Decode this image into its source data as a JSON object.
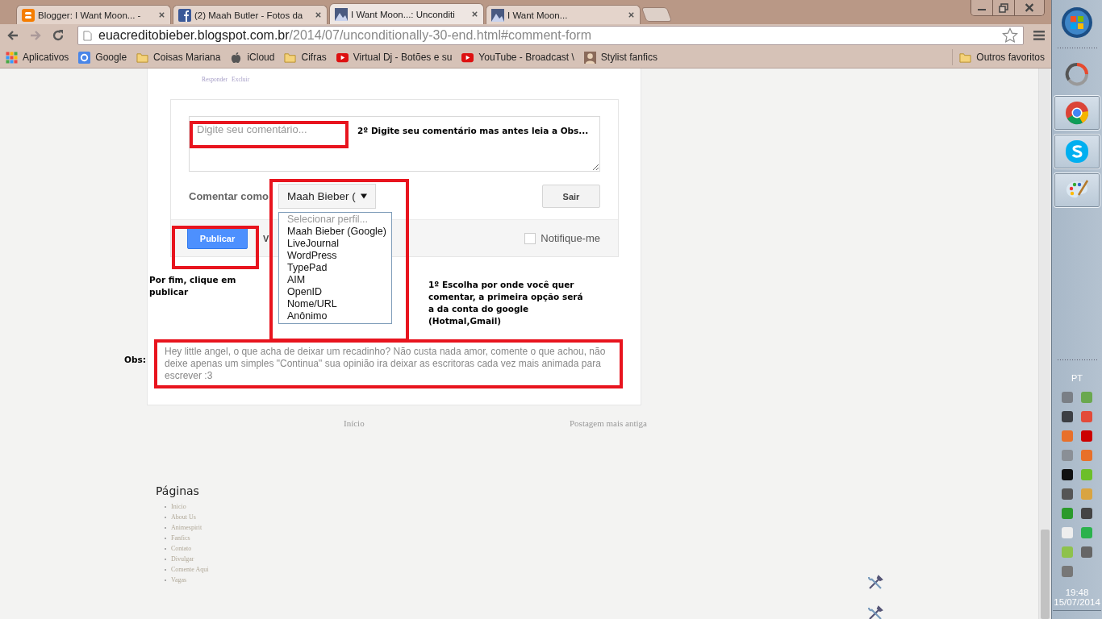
{
  "tabs": [
    {
      "title": "Blogger: I Want Moon... -",
      "kind": "blogger",
      "selected": false
    },
    {
      "title": "(2) Maah Butler - Fotos da",
      "kind": "facebook",
      "selected": false
    },
    {
      "title": "I Want Moon...: Unconditi",
      "kind": "thumb",
      "selected": true
    },
    {
      "title": "I Want Moon...",
      "kind": "thumb",
      "selected": false
    }
  ],
  "address_bar": {
    "domain": "euacreditobieber.blogspot.com.br",
    "path": "/2014/07/unconditionally-30-end.html#comment-form"
  },
  "bookmarks": [
    {
      "label": "Aplicativos",
      "kind": "apps"
    },
    {
      "label": "Google",
      "kind": "google"
    },
    {
      "label": "Coisas Mariana",
      "kind": "folder"
    },
    {
      "label": "iCloud",
      "kind": "apple"
    },
    {
      "label": "Cifras",
      "kind": "folder"
    },
    {
      "label": "Virtual Dj - Botões e su",
      "kind": "youtube"
    },
    {
      "label": "YouTube - Broadcast \\",
      "kind": "youtube"
    },
    {
      "label": "Stylist fanfics",
      "kind": "avatar"
    }
  ],
  "other_bookmarks": "Outros favoritos",
  "comment_links": [
    "Responder",
    "Excluir"
  ],
  "comment_form": {
    "placeholder": "Digite seu comentário...",
    "comment_as": "Comentar como",
    "profile": "Maah Bieber (",
    "sign_out": "Sair",
    "publish": "Publicar",
    "preview": "V",
    "notify": {
      "label": "Notifique-me",
      "checked": false
    },
    "profile_options": [
      {
        "label": "Selecionar perfil...",
        "disabled": true
      },
      {
        "label": "Maah Bieber (Google)",
        "disabled": false
      },
      {
        "label": "LiveJournal",
        "disabled": false
      },
      {
        "label": "WordPress",
        "disabled": false
      },
      {
        "label": "TypePad",
        "disabled": false
      },
      {
        "label": "AIM",
        "disabled": false
      },
      {
        "label": "OpenID",
        "disabled": false
      },
      {
        "label": "Nome/URL",
        "disabled": false
      },
      {
        "label": "Anônimo",
        "disabled": false
      }
    ]
  },
  "annotations": {
    "step2": "2º Digite seu comentário mas antes leia a Obs...",
    "publish": "Por fim, clique em publicar",
    "step1": "1º Escolha por onde você quer comentar, a primeira opção será a da conta do google (Hotmal,Gmail)",
    "obs_label": "Obs:",
    "obs_text": "Hey little angel, o que acha de deixar um recadinho? Não custa nada amor, comente o que achou, não deixe apenas um simples \"Continua\" sua opinião ira deixar as escritoras cada vez mais animada para escrever :3"
  },
  "pager": {
    "newer": "Início",
    "older": "Postagem mais antiga"
  },
  "pages": {
    "title": "Páginas",
    "items": [
      "Inicio",
      "About Us",
      "Animespirit",
      "Fanfics",
      "Contato",
      "Divulgar",
      "Comente Aqui",
      "Vagas"
    ]
  },
  "taskbar": {
    "apps": [
      {
        "kind": "arc",
        "running": false
      },
      {
        "kind": "chrome",
        "running": true
      },
      {
        "kind": "skype",
        "running": true
      },
      {
        "kind": "paint",
        "running": true
      }
    ],
    "language": "PT",
    "time": "19:48",
    "date": "15/07/2014"
  }
}
